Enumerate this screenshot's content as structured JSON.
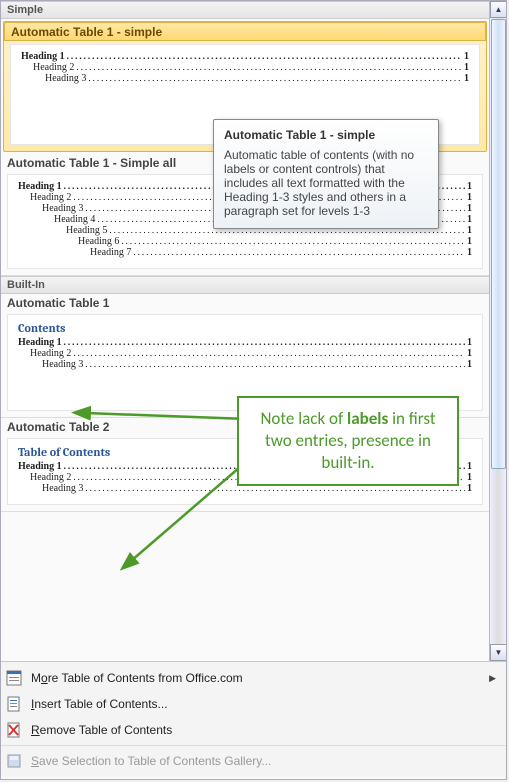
{
  "sections": {
    "simple": "Simple",
    "builtin": "Built-In"
  },
  "items": {
    "simple1": {
      "title": "Automatic Table 1 - simple",
      "rows": [
        {
          "text": "Heading 1",
          "page": "1",
          "indent": 1
        },
        {
          "text": "Heading 2",
          "page": "1",
          "indent": 2
        },
        {
          "text": "Heading 3",
          "page": "1",
          "indent": 3
        }
      ]
    },
    "simple_all": {
      "title": "Automatic Table 1 - Simple all",
      "rows": [
        {
          "text": "Heading 1",
          "page": "1",
          "indent": 1
        },
        {
          "text": "Heading 2",
          "page": "1",
          "indent": 2
        },
        {
          "text": "Heading 3",
          "page": "1",
          "indent": 3
        },
        {
          "text": "Heading 4",
          "page": "1",
          "indent": 4
        },
        {
          "text": "Heading 5",
          "page": "1",
          "indent": 5
        },
        {
          "text": "Heading 6",
          "page": "1",
          "indent": 6
        },
        {
          "text": "Heading 7",
          "page": "1",
          "indent": 7
        }
      ]
    },
    "auto1": {
      "title": "Automatic Table 1",
      "label": "Contents",
      "rows": [
        {
          "text": "Heading 1",
          "page": "1",
          "indent": 1
        },
        {
          "text": "Heading 2",
          "page": "1",
          "indent": 2
        },
        {
          "text": "Heading 3",
          "page": "1",
          "indent": 3
        }
      ]
    },
    "auto2": {
      "title": "Automatic Table 2",
      "label": "Table of Contents",
      "rows": [
        {
          "text": "Heading 1",
          "page": "1",
          "indent": 1
        },
        {
          "text": "Heading 2",
          "page": "1",
          "indent": 2
        },
        {
          "text": "Heading 3",
          "page": "1",
          "indent": 3
        }
      ]
    }
  },
  "tooltip": {
    "title": "Automatic Table 1 - simple",
    "body": "Automatic table of contents (with no labels or content controls) that includes all text formatted with the Heading 1-3 styles and others in a paragraph set for levels 1-3"
  },
  "callout": {
    "l1": "Note lack of ",
    "bold": "labels",
    "l2": " in first two entries, presence in built-in."
  },
  "menu": {
    "more_pre": "M",
    "more_ul": "o",
    "more_post": "re Table of Contents from Office.com",
    "insert_ul": "I",
    "insert_post": "nsert Table of Contents...",
    "remove_ul": "R",
    "remove_post": "emove Table of Contents",
    "save_ul": "S",
    "save_post": "ave Selection to Table of Contents Gallery..."
  }
}
